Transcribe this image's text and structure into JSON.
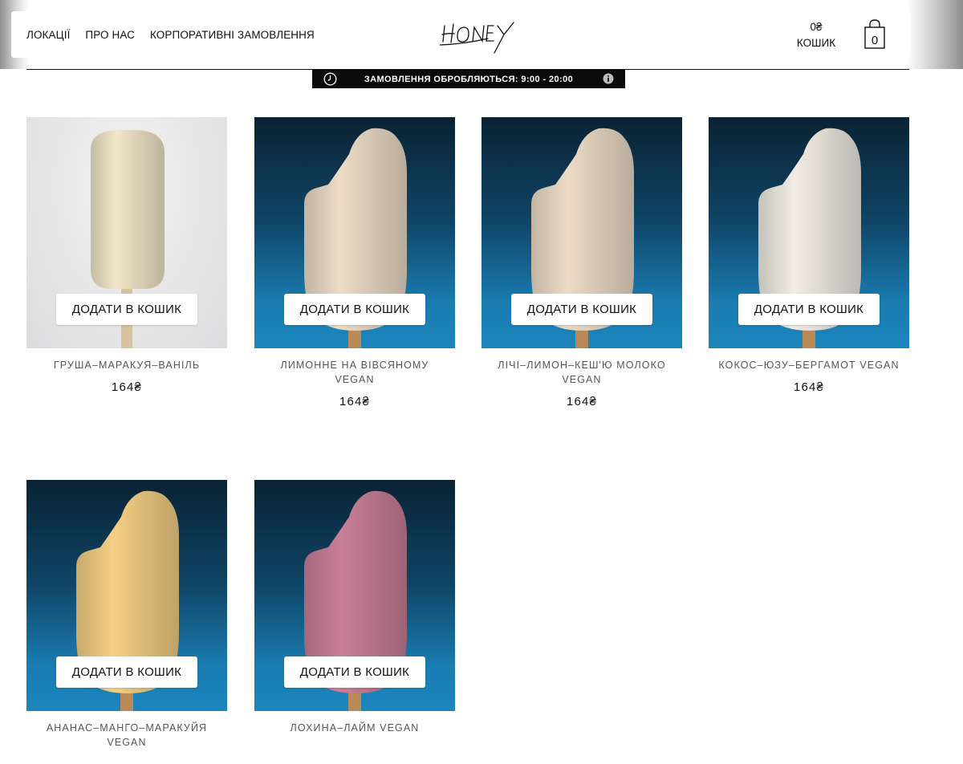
{
  "nav": {
    "items": [
      "ЛОКАЦІЇ",
      "ПРО НАС",
      "КОРПОРАТИВНІ ЗАМОВЛЕННЯ"
    ]
  },
  "logo": {
    "text": "HONEY"
  },
  "cart": {
    "total": "0₴",
    "label": "КОШИК",
    "count": "0"
  },
  "banner": {
    "text": "ЗАМОВЛЕННЯ ОБРОБЛЯЮТЬСЯ: 9:00 - 20:00"
  },
  "products": [
    {
      "name": "ГРУША–МАРАКУЯ–ВАНІЛЬ",
      "price": "164₴",
      "button": "ДОДАТИ В КОШИК",
      "bg": "white",
      "color": "#f1e6c9"
    },
    {
      "name": "ЛИМОННЕ НА ВІВСЯНОМУ VEGAN",
      "price": "164₴",
      "button": "ДОДАТИ В КОШИК",
      "bg": "blue",
      "color": "#ecdcc6"
    },
    {
      "name": "ЛІЧІ–ЛИМОН–КЕШ'Ю МОЛОКО VEGAN",
      "price": "164₴",
      "button": "ДОДАТИ В КОШИК",
      "bg": "blue",
      "color": "#ecdcc6"
    },
    {
      "name": "КОКОС–ЮЗУ–БЕРГАМОТ VEGAN",
      "price": "164₴",
      "button": "ДОДАТИ В КОШИК",
      "bg": "blue",
      "color": "#f1ede4"
    },
    {
      "name": "АНАНАС–МАНГО–МАРАКУЙЯ VEGAN",
      "price": "",
      "button": "ДОДАТИ В КОШИК",
      "bg": "blue",
      "color": "#f4cf85"
    },
    {
      "name": "ЛОХИНА–ЛАЙМ VEGAN",
      "price": "",
      "button": "ДОДАТИ В КОШИК",
      "bg": "blue",
      "color": "#c87f97"
    }
  ]
}
